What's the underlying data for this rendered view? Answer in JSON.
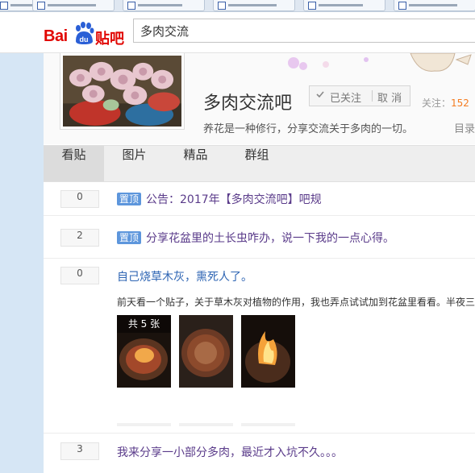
{
  "browser": {
    "tabs": [
      {
        "title": ""
      },
      {
        "title": ""
      },
      {
        "title": ""
      },
      {
        "title": ""
      },
      {
        "title": ""
      },
      {
        "title": ""
      }
    ]
  },
  "header": {
    "logo_bai": "Bai",
    "logo_du": "du",
    "logo_tieba": "贴吧",
    "search_value": "多肉交流",
    "brand_color": "#e10602",
    "paw_color": "#2a5fd6"
  },
  "forum": {
    "name": "多肉交流吧",
    "followed_label": "已关注",
    "cancel_label": "取 消",
    "followers_label": "关注：",
    "followers_count": "152",
    "slogan": "养花是一种修行，分享交流关于多肉的一切。",
    "catalog_link": "目录"
  },
  "tabs": [
    {
      "label": "看贴",
      "active": true
    },
    {
      "label": "图片",
      "active": false
    },
    {
      "label": "精品",
      "active": false
    },
    {
      "label": "群组",
      "active": false
    }
  ],
  "threads": [
    {
      "replies": "0",
      "pinned": true,
      "pin_label": "置顶",
      "title": "公告：2017年【多肉交流吧】吧规"
    },
    {
      "replies": "2",
      "pinned": true,
      "pin_label": "置顶",
      "title": "分享花盆里的土长虫咋办，说一下我的一点心得。"
    },
    {
      "replies": "0",
      "pinned": false,
      "title": "自己烧草木灰，熏死人了。",
      "abstract": "前天看一个贴子，关于草木灰对植物的作用，我也弄点试试加到花盆里看看。半夜三",
      "image_count_label": "共 5 张"
    },
    {
      "replies": "3",
      "pinned": false,
      "title": "我来分享一小部分多肉，最近才入坑不久。。。"
    }
  ]
}
